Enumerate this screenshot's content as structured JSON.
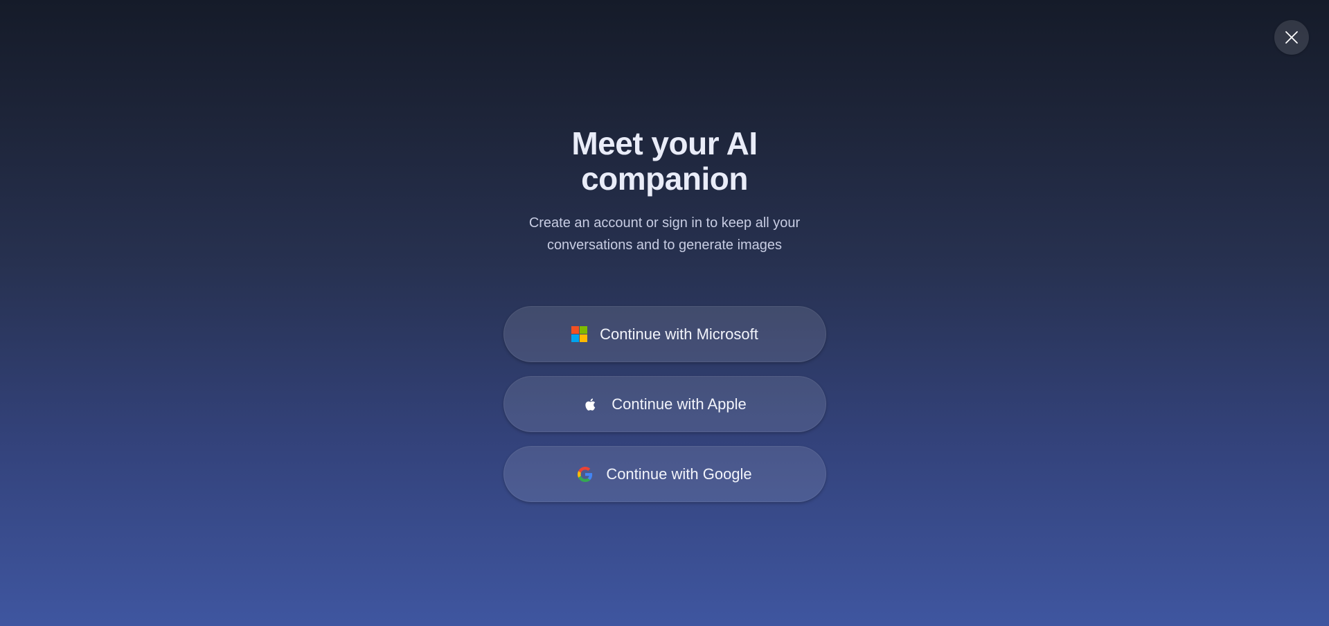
{
  "dialog": {
    "title": "Meet your AI companion",
    "subtitle": "Create an account or sign in to keep all your conversations and to generate images",
    "close_icon": "close-icon"
  },
  "buttons": [
    {
      "label": "Continue with Microsoft",
      "icon": "microsoft-icon"
    },
    {
      "label": "Continue with Apple",
      "icon": "apple-icon"
    },
    {
      "label": "Continue with Google",
      "icon": "google-icon"
    }
  ],
  "colors": {
    "background_top": "#151b29",
    "background_bottom": "#3f56a0",
    "microsoft": [
      "#f25022",
      "#7fba00",
      "#00a4ef",
      "#ffb900"
    ],
    "google": [
      "#4285f4",
      "#ea4335",
      "#fbbc05",
      "#34a853"
    ]
  }
}
